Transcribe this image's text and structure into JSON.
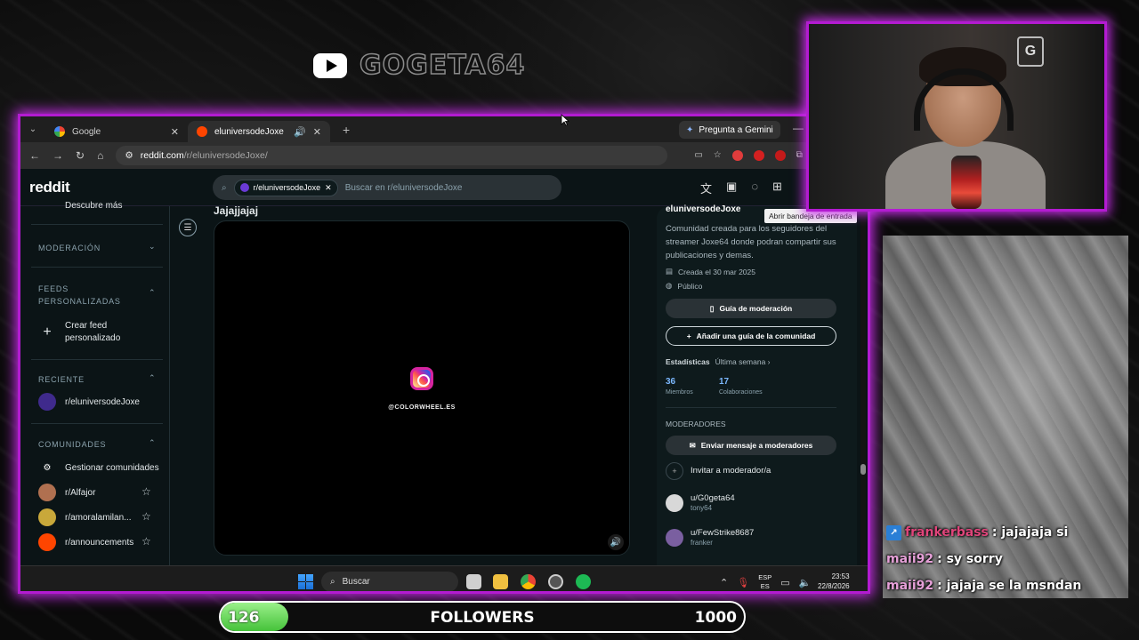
{
  "overlay": {
    "channel_name": "GOGETA64",
    "followers": {
      "current": "126",
      "label": "FOLLOWERS",
      "goal": "1000",
      "progress": 0.126
    },
    "accent_color": "#c52ce6"
  },
  "browser": {
    "tabs": [
      {
        "title": "Google",
        "favicon": "google-icon"
      },
      {
        "title": "eluniversodeJoxe",
        "favicon": "reddit-icon",
        "active": true
      }
    ],
    "gemini_label": "Pregunta a Gemini",
    "address": {
      "host": "reddit.com",
      "path": "/r/eluniversodeJoxe/"
    }
  },
  "reddit": {
    "logo": "reddit",
    "search": {
      "chip": "r/eluniversodeJoxe",
      "placeholder": "Buscar en r/eluniversodeJoxe"
    },
    "tooltip": "Abrir bandeja de entrada",
    "sidebar": {
      "discover": "Descubre más",
      "moderation": "MODERACIÓN",
      "custom_feeds": "FEEDS PERSONALIZADAS",
      "create_feed": "Crear feed personalizado",
      "recent": "RECIENTE",
      "recent_item": "r/eluniversodeJoxe",
      "communities": "COMUNIDADES",
      "manage": "Gestionar comunidades",
      "community_items": [
        "r/Alfajor",
        "r/amoralamilan...",
        "r/announcements"
      ]
    },
    "post": {
      "title": "Jajajjajaj",
      "media_caption": "@COLORWHEEL.ES"
    },
    "about": {
      "name": "eluniversodeJoxe",
      "description": "Comunidad creada para los seguidores del streamer Joxe64 donde podran compartir sus publicaciones y demas.",
      "created": "Creada el 30 mar 2025",
      "visibility": "Público",
      "mod_guide_btn": "Guía de moderación",
      "add_guide_btn": "Añadir una guía de la comunidad",
      "stats_label": "Estadísticas",
      "stats_period": "Última semana ›",
      "members_count": "36",
      "members_label": "Miembros",
      "contrib_count": "17",
      "contrib_label": "Colaboraciones",
      "moderators_head": "MODERADORES",
      "message_mods_btn": "Enviar mensaje a moderadores",
      "invite_mod": "Invitar a moderador/a",
      "moderators": [
        {
          "name": "u/G0geta64",
          "flair": "tony64"
        },
        {
          "name": "u/FewStrike8687",
          "flair": "franker"
        }
      ]
    }
  },
  "taskbar": {
    "search": "Buscar",
    "lang_top": "ESP",
    "lang_bottom": "ES",
    "time": "23:53",
    "date": "22/8/2026"
  },
  "chat": [
    {
      "user": "frankerbass",
      "message": ": jajajaja si",
      "color": "#e0457b",
      "badge": true
    },
    {
      "user": "maii92",
      "message": ": sy sorry",
      "color": "#e6a0d8",
      "badge": false
    },
    {
      "user": "maii92",
      "message": ": jajaja se la msndan",
      "color": "#e6a0d8",
      "badge": false
    }
  ]
}
